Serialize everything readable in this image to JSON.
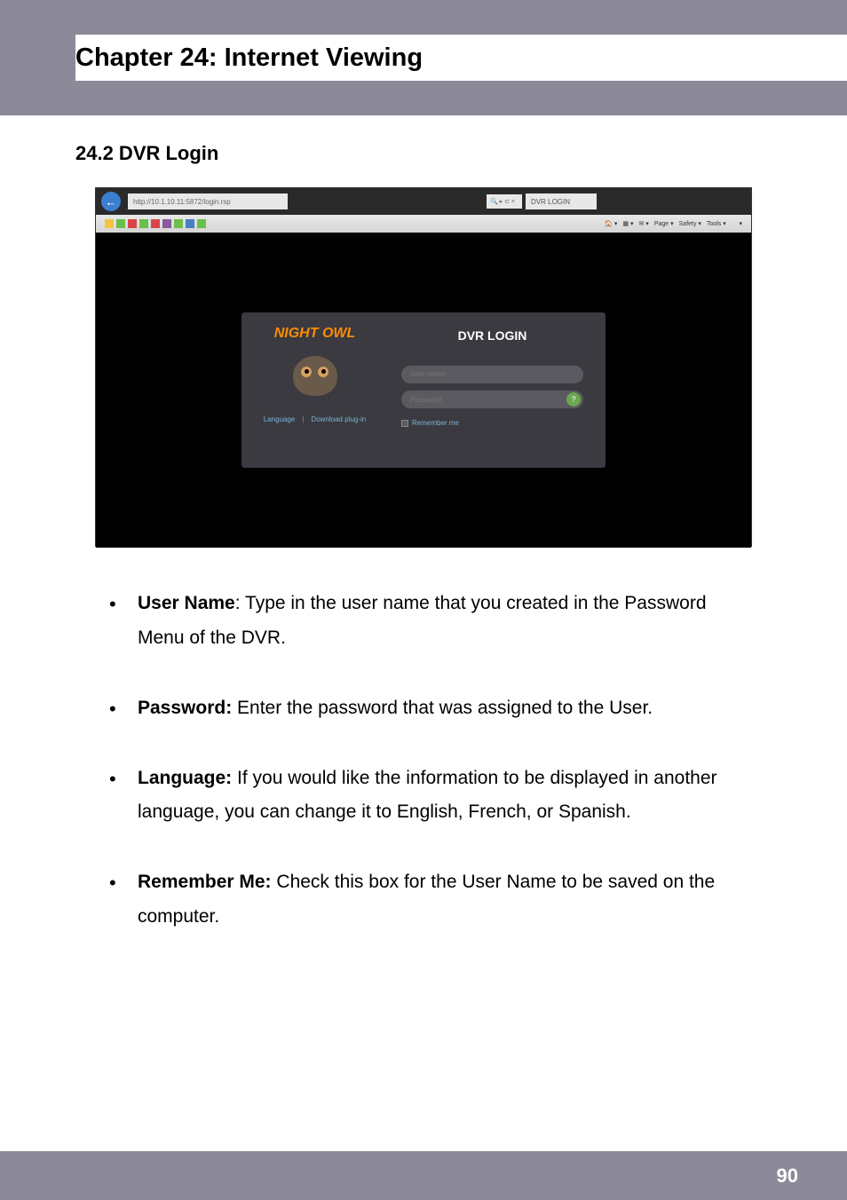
{
  "chapter": {
    "title": "Chapter 24: Internet Viewing"
  },
  "section": {
    "title": "24.2 DVR Login"
  },
  "screenshot": {
    "address_text": "http://10.1.10.11:5872/login.rsp",
    "search_text": "🔍 ▸ ⊂ ×",
    "tab_text": "DVR LOGIN",
    "ie_menu": {
      "page": "Page ▾",
      "safety": "Safety ▾",
      "tools": "Tools ▾"
    },
    "brand": "NIGHT OWL",
    "links": {
      "language": "Language",
      "separator": "|",
      "download": "Download plug-in"
    },
    "login": {
      "heading": "DVR LOGIN",
      "username_placeholder": "User name",
      "password_placeholder": "Password",
      "question": "?",
      "remember": "Remember me"
    },
    "fav_colors": [
      "#f5c542",
      "#6abf4b",
      "#d94545",
      "#6abf4b",
      "#d94545",
      "#8a5a9e",
      "#6abf4b",
      "#4a7fc1",
      "#6abf4b"
    ]
  },
  "bullets": [
    {
      "label": "User Name",
      "suffix": ":",
      "text": " Type in the user name that you created in the Password Menu of the DVR."
    },
    {
      "label": "Password:",
      "suffix": "",
      "text": " Enter the password that was assigned to the User."
    },
    {
      "label": "Language:",
      "suffix": "",
      "text": " If you would like the information to be displayed in another language, you can change it to English, French, or Spanish."
    },
    {
      "label": "Remember Me:",
      "suffix": "",
      "text": " Check this box for the User Name to be saved on the computer."
    }
  ],
  "footer": {
    "page_number": "90"
  }
}
